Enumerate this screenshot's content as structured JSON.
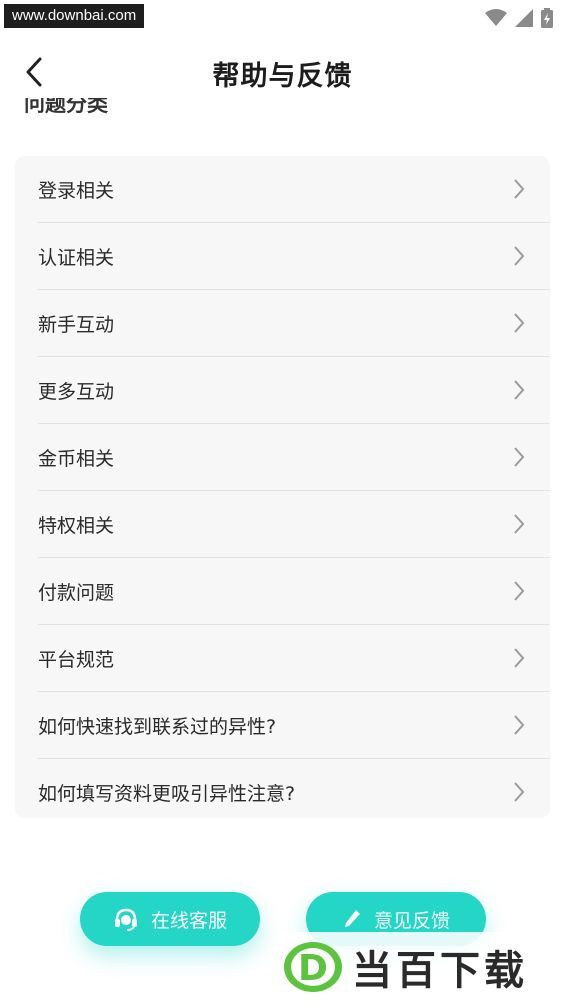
{
  "status_bar": {
    "watermark_url": "www.downbai.com",
    "icons": [
      "wifi-icon",
      "signal-icon",
      "battery-icon"
    ]
  },
  "header": {
    "title": "帮助与反馈",
    "back_icon": "chevron-left-icon"
  },
  "section": {
    "title": "问题分类"
  },
  "faq_items": [
    {
      "label": "登录相关"
    },
    {
      "label": "认证相关"
    },
    {
      "label": "新手互动"
    },
    {
      "label": "更多互动"
    },
    {
      "label": "金币相关"
    },
    {
      "label": "特权相关"
    },
    {
      "label": "付款问题"
    },
    {
      "label": "平台规范"
    },
    {
      "label": "如何快速找到联系过的异性?"
    },
    {
      "label": "如何填写资料更吸引异性注意?"
    }
  ],
  "actions": {
    "service_label": "在线客服",
    "service_icon": "headset-icon",
    "feedback_label": "意见反馈",
    "feedback_icon": "pen-icon"
  },
  "brand": {
    "text": "当百下载",
    "mark": "D"
  },
  "colors": {
    "accent": "#23d6c6",
    "card_bg": "#f7f7f7",
    "divider": "#e2e2e2",
    "brand_green": "#5cc43c"
  }
}
